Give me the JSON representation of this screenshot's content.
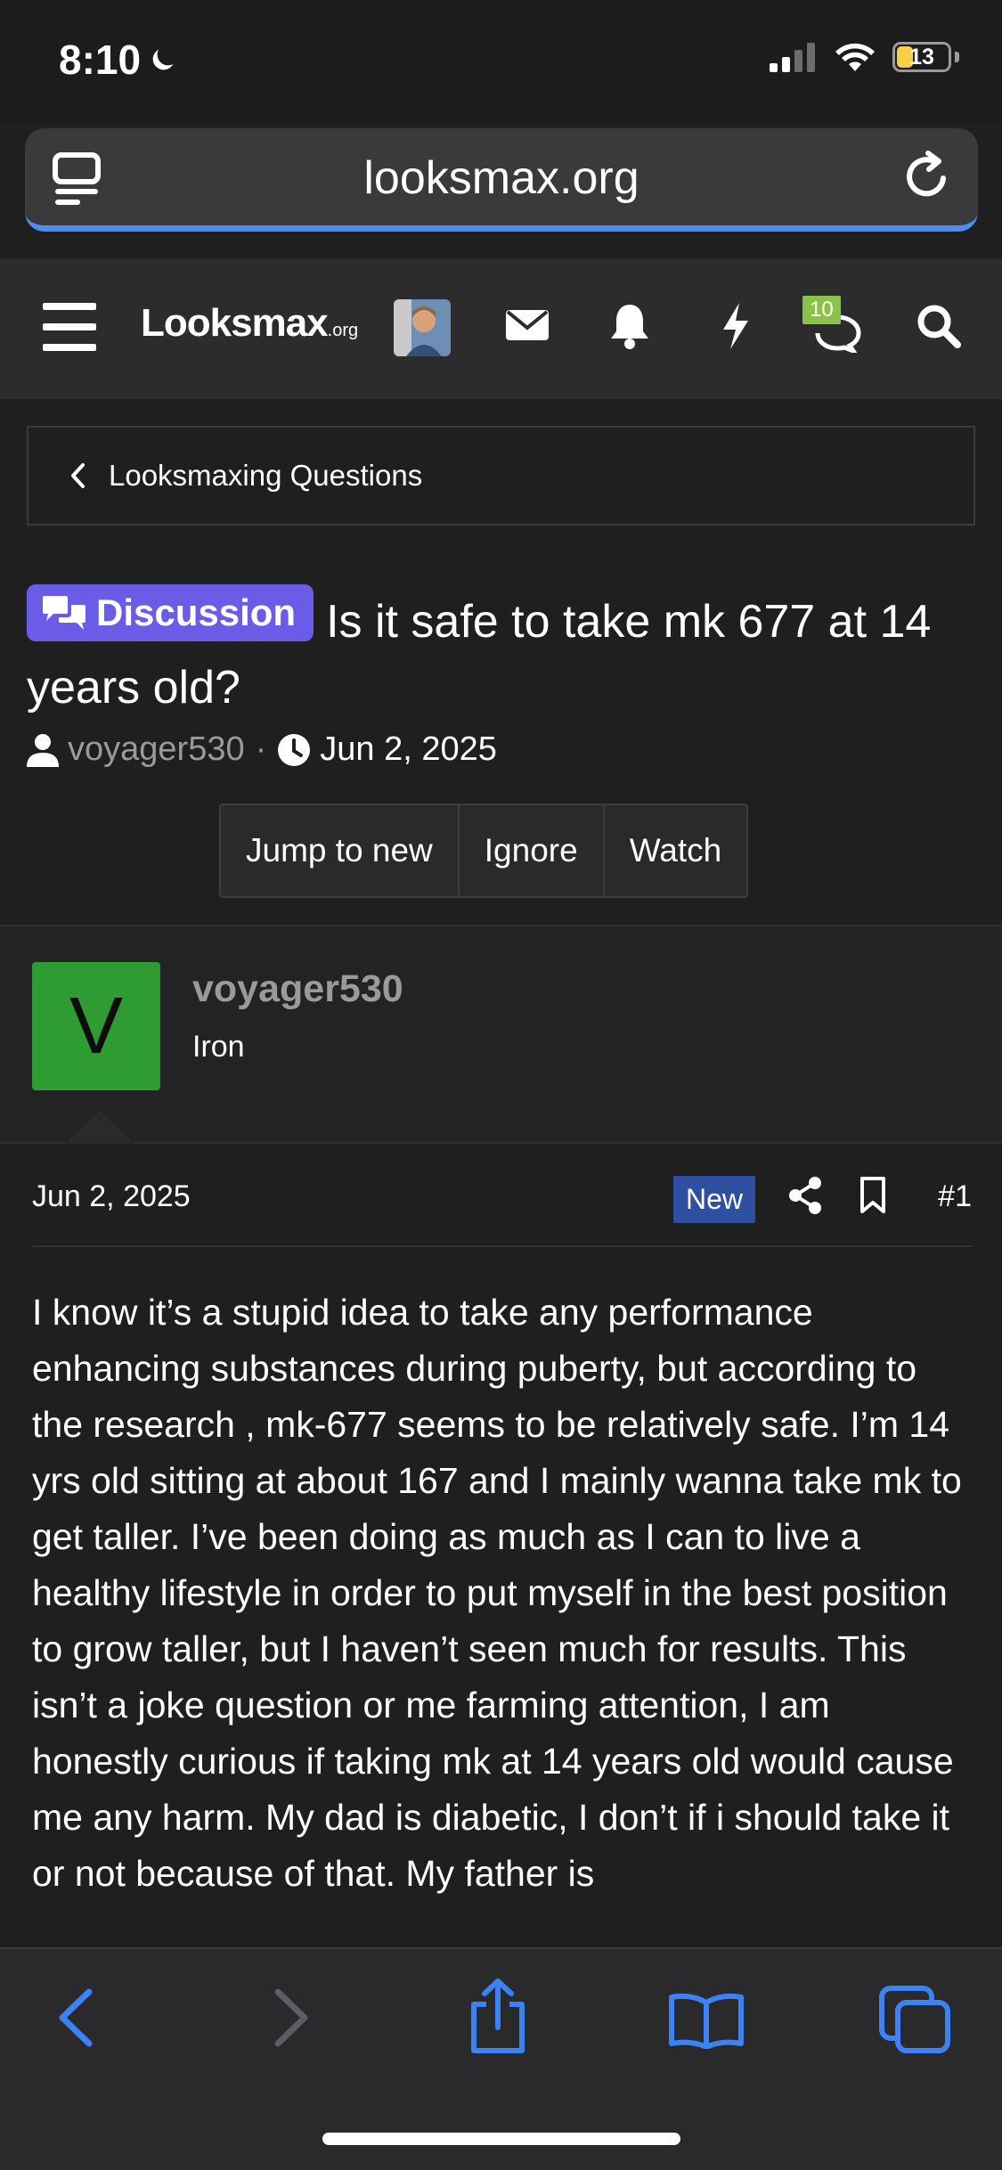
{
  "status_bar": {
    "time": "8:10",
    "battery_percent": "13"
  },
  "url_bar": {
    "url": "looksmax.org"
  },
  "header": {
    "logo_main": "Looksmax",
    "logo_suffix": ".org",
    "conversations_count": "10",
    "icons": [
      "menu-icon",
      "avatar",
      "envelope-icon",
      "bell-icon",
      "bolt-icon",
      "chat-icon",
      "search-icon"
    ]
  },
  "breadcrumb": {
    "label": "Looksmaxing Questions"
  },
  "thread": {
    "prefix": "Discussion",
    "title": "Is it safe to take mk 677 at 14 years old?",
    "author": "voyager530",
    "separator": "·",
    "date": "Jun 2, 2025",
    "buttons": {
      "jump": "Jump to new",
      "ignore": "Ignore",
      "watch": "Watch"
    }
  },
  "post": {
    "avatar_letter": "V",
    "username": "voyager530",
    "user_title": "Iron",
    "date": "Jun 2, 2025",
    "new_label": "New",
    "number": "#1",
    "body": "I know it’s a stupid idea to take any performance enhancing substances during puberty, but according to the research , mk-677 seems to be relatively safe. I’m 14 yrs old sitting at about 167 and I mainly wanna take mk to get taller. I’ve been doing as much as I can to live a healthy lifestyle in order to put myself in the best position to grow taller, but I haven’t seen much for results. This isn’t a joke question or me farming attention, I am honestly curious if taking mk at 14 years old would cause me any harm. My dad is diabetic, I don’t if i should take it or not because of that. My father is"
  },
  "colors": {
    "page_bg": "#1f1f1f",
    "prefix_badge": "#6b5ce7",
    "avatar_green": "#2e9b33",
    "new_badge": "#2f4fa0",
    "safari_blue": "#4a8ff0",
    "badge_green": "#8bc34a"
  }
}
